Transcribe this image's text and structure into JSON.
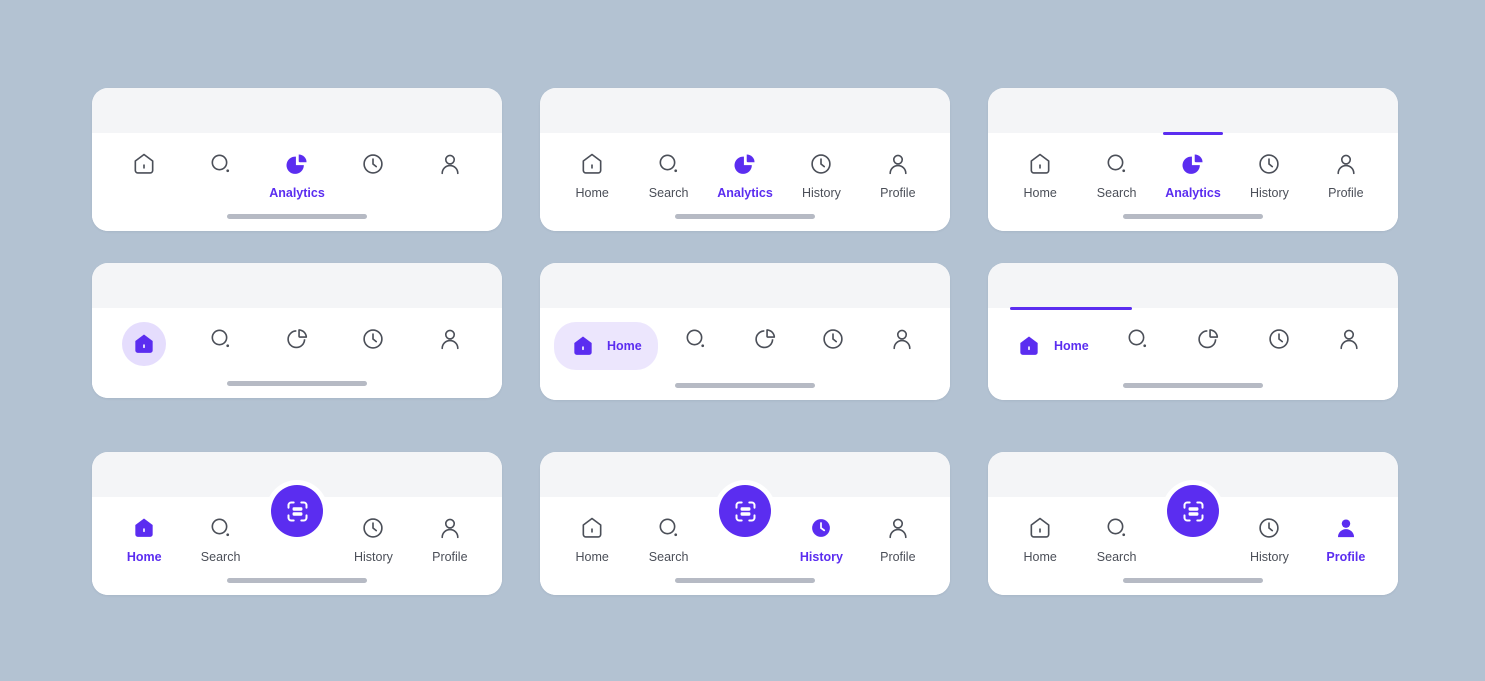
{
  "meta": {
    "background_color": "#b3c2d2",
    "card_color": "#ffffff",
    "card_strip_color": "#f4f5f7",
    "accent_color": "#5b2df0",
    "accent_soft_color": "#ece6fd",
    "accent_circle_color": "#e5ddfd",
    "inactive_label_color": "#4b4f58",
    "home_indicator_color": "#b6bac4"
  },
  "labels": {
    "home": "Home",
    "search": "Search",
    "analytics": "Analytics",
    "history": "History",
    "profile": "Profile",
    "scan": "Scan"
  },
  "icons": {
    "home": "home-icon",
    "search": "search-icon",
    "analytics": "pie-chart-icon",
    "history": "clock-icon",
    "profile": "person-icon",
    "scan": "scan-icon"
  },
  "cards": [
    {
      "id": "nav-icons-active-label-only",
      "variant": "icon-only-active-label",
      "active_index": 2,
      "show_labels_only_active": true,
      "top_indicator": false,
      "items": [
        {
          "key": "home",
          "label": "Home",
          "icon": "home-icon",
          "active": false,
          "filled": false
        },
        {
          "key": "search",
          "label": "Search",
          "icon": "search-icon",
          "active": false,
          "filled": false
        },
        {
          "key": "analytics",
          "label": "Analytics",
          "icon": "pie-chart-icon",
          "active": true,
          "filled": true
        },
        {
          "key": "history",
          "label": "History",
          "icon": "clock-icon",
          "active": false,
          "filled": false
        },
        {
          "key": "profile",
          "label": "Profile",
          "icon": "person-icon",
          "active": false,
          "filled": false
        }
      ]
    },
    {
      "id": "nav-icons-all-labels",
      "variant": "all-labels",
      "active_index": 2,
      "show_labels_only_active": false,
      "top_indicator": false,
      "items": [
        {
          "key": "home",
          "label": "Home",
          "icon": "home-icon",
          "active": false,
          "filled": false
        },
        {
          "key": "search",
          "label": "Search",
          "icon": "search-icon",
          "active": false,
          "filled": false
        },
        {
          "key": "analytics",
          "label": "Analytics",
          "icon": "pie-chart-icon",
          "active": true,
          "filled": true
        },
        {
          "key": "history",
          "label": "History",
          "icon": "clock-icon",
          "active": false,
          "filled": false
        },
        {
          "key": "profile",
          "label": "Profile",
          "icon": "person-icon",
          "active": false,
          "filled": false
        }
      ]
    },
    {
      "id": "nav-labels-top-indicator",
      "variant": "all-labels-top-indicator",
      "active_index": 2,
      "show_labels_only_active": false,
      "top_indicator": true,
      "items": [
        {
          "key": "home",
          "label": "Home",
          "icon": "home-icon",
          "active": false,
          "filled": false
        },
        {
          "key": "search",
          "label": "Search",
          "icon": "search-icon",
          "active": false,
          "filled": false
        },
        {
          "key": "analytics",
          "label": "Analytics",
          "icon": "pie-chart-icon",
          "active": true,
          "filled": true
        },
        {
          "key": "history",
          "label": "History",
          "icon": "clock-icon",
          "active": false,
          "filled": false
        },
        {
          "key": "profile",
          "label": "Profile",
          "icon": "person-icon",
          "active": false,
          "filled": false
        }
      ]
    },
    {
      "id": "nav-circle-highlight",
      "variant": "circle-highlight",
      "active_index": 0,
      "show_labels_only_active": false,
      "hide_all_labels": true,
      "top_indicator": false,
      "items": [
        {
          "key": "home",
          "label": "Home",
          "icon": "home-icon",
          "active": true,
          "filled": true
        },
        {
          "key": "search",
          "label": "Search",
          "icon": "search-icon",
          "active": false,
          "filled": false
        },
        {
          "key": "analytics",
          "label": "Analytics",
          "icon": "pie-chart-icon",
          "active": false,
          "filled": false
        },
        {
          "key": "history",
          "label": "History",
          "icon": "clock-icon",
          "active": false,
          "filled": false
        },
        {
          "key": "profile",
          "label": "Profile",
          "icon": "person-icon",
          "active": false,
          "filled": false
        }
      ]
    },
    {
      "id": "nav-pill-label",
      "variant": "pill-label",
      "active_index": 0,
      "show_labels_only_active": true,
      "top_indicator": false,
      "items": [
        {
          "key": "home",
          "label": "Home",
          "icon": "home-icon",
          "active": true,
          "filled": true
        },
        {
          "key": "search",
          "label": "Search",
          "icon": "search-icon",
          "active": false,
          "filled": false
        },
        {
          "key": "analytics",
          "label": "Analytics",
          "icon": "pie-chart-icon",
          "active": false,
          "filled": false
        },
        {
          "key": "history",
          "label": "History",
          "icon": "clock-icon",
          "active": false,
          "filled": false
        },
        {
          "key": "profile",
          "label": "Profile",
          "icon": "person-icon",
          "active": false,
          "filled": false
        }
      ]
    },
    {
      "id": "nav-inline-label-top-indicator",
      "variant": "inline-label-top-indicator",
      "active_index": 0,
      "show_labels_only_active": true,
      "top_indicator": true,
      "items": [
        {
          "key": "home",
          "label": "Home",
          "icon": "home-icon",
          "active": true,
          "filled": true
        },
        {
          "key": "search",
          "label": "Search",
          "icon": "search-icon",
          "active": false,
          "filled": false
        },
        {
          "key": "analytics",
          "label": "Analytics",
          "icon": "pie-chart-icon",
          "active": false,
          "filled": false
        },
        {
          "key": "history",
          "label": "History",
          "icon": "clock-icon",
          "active": false,
          "filled": false
        },
        {
          "key": "profile",
          "label": "Profile",
          "icon": "person-icon",
          "active": false,
          "filled": false
        }
      ]
    },
    {
      "id": "nav-fab-home-active",
      "variant": "fab",
      "active_index": 0,
      "show_labels_only_active": false,
      "top_indicator": false,
      "items": [
        {
          "key": "home",
          "label": "Home",
          "icon": "home-icon",
          "active": true,
          "filled": true
        },
        {
          "key": "search",
          "label": "Search",
          "icon": "search-icon",
          "active": false,
          "filled": false
        },
        {
          "key": "scan",
          "label": "Scan",
          "icon": "scan-icon",
          "active": false,
          "filled": true,
          "fab": true
        },
        {
          "key": "history",
          "label": "History",
          "icon": "clock-icon",
          "active": false,
          "filled": false
        },
        {
          "key": "profile",
          "label": "Profile",
          "icon": "person-icon",
          "active": false,
          "filled": false
        }
      ]
    },
    {
      "id": "nav-fab-history-active",
      "variant": "fab",
      "active_index": 3,
      "show_labels_only_active": false,
      "top_indicator": false,
      "items": [
        {
          "key": "home",
          "label": "Home",
          "icon": "home-icon",
          "active": false,
          "filled": false
        },
        {
          "key": "search",
          "label": "Search",
          "icon": "search-icon",
          "active": false,
          "filled": false
        },
        {
          "key": "scan",
          "label": "Scan",
          "icon": "scan-icon",
          "active": false,
          "filled": true,
          "fab": true
        },
        {
          "key": "history",
          "label": "History",
          "icon": "clock-icon",
          "active": true,
          "filled": true
        },
        {
          "key": "profile",
          "label": "Profile",
          "icon": "person-icon",
          "active": false,
          "filled": false
        }
      ]
    },
    {
      "id": "nav-fab-profile-active",
      "variant": "fab",
      "active_index": 4,
      "show_labels_only_active": false,
      "top_indicator": false,
      "items": [
        {
          "key": "home",
          "label": "Home",
          "icon": "home-icon",
          "active": false,
          "filled": false
        },
        {
          "key": "search",
          "label": "Search",
          "icon": "search-icon",
          "active": false,
          "filled": false
        },
        {
          "key": "scan",
          "label": "Scan",
          "icon": "scan-icon",
          "active": false,
          "filled": true,
          "fab": true
        },
        {
          "key": "history",
          "label": "History",
          "icon": "clock-icon",
          "active": false,
          "filled": false
        },
        {
          "key": "profile",
          "label": "Profile",
          "icon": "person-icon",
          "active": true,
          "filled": true
        }
      ]
    }
  ]
}
